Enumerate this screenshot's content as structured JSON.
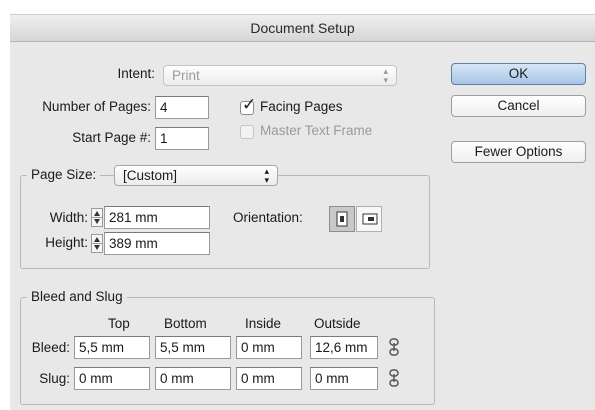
{
  "window": {
    "title": "Document Setup"
  },
  "intent": {
    "label": "Intent:",
    "value": "Print"
  },
  "pages": {
    "number_label": "Number of Pages:",
    "number_value": "4",
    "start_label": "Start Page #:",
    "start_value": "1",
    "facing_label": "Facing Pages",
    "facing_checked": true,
    "master_label": "Master Text Frame",
    "master_checked": false
  },
  "page_size": {
    "label": "Page Size:",
    "value": "[Custom]",
    "width_label": "Width:",
    "width_value": "281 mm",
    "height_label": "Height:",
    "height_value": "389 mm",
    "orientation_label": "Orientation:",
    "orientation_selected": "portrait",
    "orientation_icons": [
      "portrait-orientation-icon",
      "landscape-orientation-icon"
    ]
  },
  "bleed_slug": {
    "legend": "Bleed and Slug",
    "columns": [
      "Top",
      "Bottom",
      "Inside",
      "Outside"
    ],
    "rows": [
      {
        "label": "Bleed:",
        "values": [
          "5,5 mm",
          "5,5 mm",
          "0 mm",
          "12,6 mm"
        ]
      },
      {
        "label": "Slug:",
        "values": [
          "0 mm",
          "0 mm",
          "0 mm",
          "0 mm"
        ]
      }
    ]
  },
  "buttons": {
    "ok": "OK",
    "cancel": "Cancel",
    "fewer": "Fewer Options"
  },
  "colors": {
    "default_button": "#a7c5e6",
    "dialog_bg": "#e8e8e8"
  }
}
